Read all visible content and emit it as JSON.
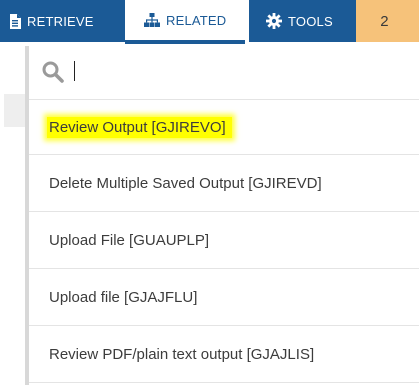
{
  "toolbar": {
    "retrieve_label": "RETRIEVE",
    "retrieve_icon": "document-icon",
    "related_label": "RELATED",
    "related_icon": "sitemap-icon",
    "tools_label": "TOOLS",
    "tools_icon": "gear-icon",
    "badge_count": "2"
  },
  "search": {
    "placeholder": "",
    "value": "",
    "icon": "search-icon"
  },
  "related_items": [
    {
      "label": "Review Output [GJIREVO]",
      "highlighted": true
    },
    {
      "label": "Delete Multiple Saved Output [GJIREVD]"
    },
    {
      "label": "Upload File [GUAUPLP]"
    },
    {
      "label": "Upload file [GJAJFLU]"
    },
    {
      "label": "Review PDF/plain text output [GJAJLIS]"
    }
  ],
  "colors": {
    "toolbar_blue": "#1b5a96",
    "badge_orange": "#f6c27a",
    "highlight_yellow": "#ffff00",
    "item_text": "#3c3c3c"
  }
}
